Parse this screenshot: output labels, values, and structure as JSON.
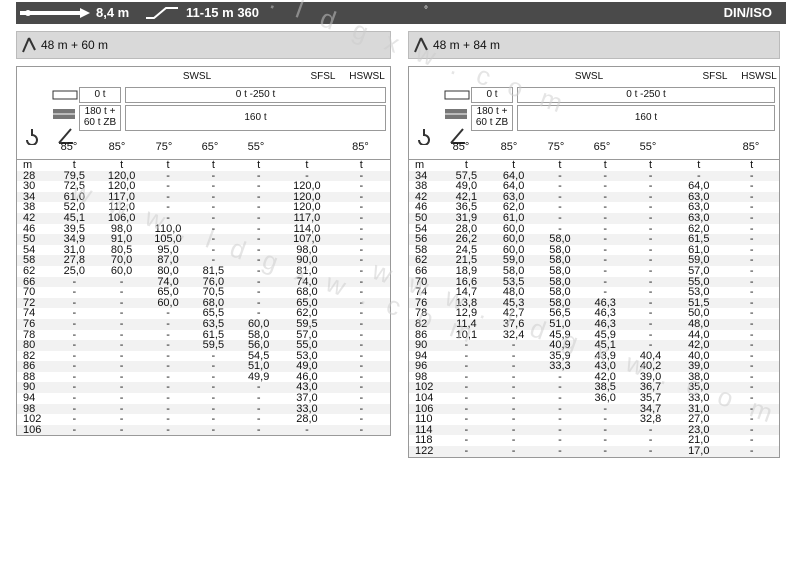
{
  "topbar": {
    "boom_length": "8,4 m",
    "range": "11-15 m 360",
    "dot": "°",
    "standard": "DIN/ISO"
  },
  "left": {
    "boom": "48 m + 60 m",
    "swsl": "SWSL",
    "sfsl": "SFSL",
    "hswsl": "HSWSL",
    "cw1": "0 t",
    "cw2": "0 t -250 t",
    "ballast1": "180 t +\n60 t ZB",
    "ballast2": "160 t",
    "angles": [
      "85°",
      "85°",
      "75°",
      "65°",
      "55°",
      "",
      "85°"
    ],
    "units": [
      "m",
      "t",
      "t",
      "t",
      "t",
      "t",
      "t",
      "t"
    ],
    "rows": [
      [
        "28",
        "79,5",
        "120,0",
        "-",
        "-",
        "-",
        "-",
        "-"
      ],
      [
        "30",
        "72,5",
        "120,0",
        "-",
        "-",
        "-",
        "120,0",
        "-"
      ],
      [
        "34",
        "61,0",
        "117,0",
        "-",
        "-",
        "-",
        "120,0",
        "-"
      ],
      [
        "38",
        "52,0",
        "112,0",
        "-",
        "-",
        "-",
        "120,0",
        "-"
      ],
      [
        "42",
        "45,1",
        "106,0",
        "-",
        "-",
        "-",
        "117,0",
        "-"
      ],
      [
        "46",
        "39,5",
        "98,0",
        "110,0",
        "-",
        "-",
        "114,0",
        "-"
      ],
      [
        "50",
        "34,9",
        "91,0",
        "105,0",
        "-",
        "-",
        "107,0",
        "-"
      ],
      [
        "54",
        "31,0",
        "80,5",
        "95,0",
        "-",
        "-",
        "98,0",
        "-"
      ],
      [
        "58",
        "27,8",
        "70,0",
        "87,0",
        "-",
        "-",
        "90,0",
        "-"
      ],
      [
        "62",
        "25,0",
        "60,0",
        "80,0",
        "81,5",
        "-",
        "81,0",
        "-"
      ],
      [
        "66",
        "-",
        "-",
        "74,0",
        "76,0",
        "-",
        "74,0",
        "-"
      ],
      [
        "70",
        "-",
        "-",
        "65,0",
        "70,5",
        "-",
        "68,0",
        "-"
      ],
      [
        "72",
        "-",
        "-",
        "60,0",
        "68,0",
        "-",
        "65,0",
        "-"
      ],
      [
        "74",
        "-",
        "-",
        "-",
        "65,5",
        "-",
        "62,0",
        "-"
      ],
      [
        "76",
        "-",
        "-",
        "-",
        "63,5",
        "60,0",
        "59,5",
        "-"
      ],
      [
        "78",
        "-",
        "-",
        "-",
        "61,5",
        "58,0",
        "57,0",
        "-"
      ],
      [
        "80",
        "-",
        "-",
        "-",
        "59,5",
        "56,0",
        "55,0",
        "-"
      ],
      [
        "82",
        "-",
        "-",
        "-",
        "-",
        "54,5",
        "53,0",
        "-"
      ],
      [
        "86",
        "-",
        "-",
        "-",
        "-",
        "51,0",
        "49,0",
        "-"
      ],
      [
        "88",
        "-",
        "-",
        "-",
        "-",
        "49,9",
        "46,0",
        "-"
      ],
      [
        "90",
        "-",
        "-",
        "-",
        "-",
        "-",
        "43,0",
        "-"
      ],
      [
        "94",
        "-",
        "-",
        "-",
        "-",
        "-",
        "37,0",
        "-"
      ],
      [
        "98",
        "-",
        "-",
        "-",
        "-",
        "-",
        "33,0",
        "-"
      ],
      [
        "102",
        "-",
        "-",
        "-",
        "-",
        "-",
        "28,0",
        "-"
      ],
      [
        "106",
        "-",
        "-",
        "-",
        "-",
        "-",
        "-",
        "-"
      ]
    ]
  },
  "right": {
    "boom": "48 m + 84 m",
    "swsl": "SWSL",
    "sfsl": "SFSL",
    "hswsl": "HSWSL",
    "cw1": "0 t",
    "cw2": "0 t -250 t",
    "ballast1": "180 t +\n60 t ZB",
    "ballast2": "160 t",
    "angles": [
      "85°",
      "85°",
      "75°",
      "65°",
      "55°",
      "",
      "85°"
    ],
    "units": [
      "m",
      "t",
      "t",
      "t",
      "t",
      "t",
      "t",
      "t"
    ],
    "rows": [
      [
        "34",
        "57,5",
        "64,0",
        "-",
        "-",
        "-",
        "-",
        "-"
      ],
      [
        "38",
        "49,0",
        "64,0",
        "-",
        "-",
        "-",
        "64,0",
        "-"
      ],
      [
        "42",
        "42,1",
        "63,0",
        "-",
        "-",
        "-",
        "63,0",
        "-"
      ],
      [
        "46",
        "36,5",
        "62,0",
        "-",
        "-",
        "-",
        "63,0",
        "-"
      ],
      [
        "50",
        "31,9",
        "61,0",
        "-",
        "-",
        "-",
        "63,0",
        "-"
      ],
      [
        "54",
        "28,0",
        "60,0",
        "-",
        "-",
        "-",
        "62,0",
        "-"
      ],
      [
        "56",
        "26,2",
        "60,0",
        "58,0",
        "-",
        "-",
        "61,5",
        "-"
      ],
      [
        "58",
        "24,5",
        "60,0",
        "58,0",
        "-",
        "-",
        "61,0",
        "-"
      ],
      [
        "62",
        "21,5",
        "59,0",
        "58,0",
        "-",
        "-",
        "59,0",
        "-"
      ],
      [
        "66",
        "18,9",
        "58,0",
        "58,0",
        "-",
        "-",
        "57,0",
        "-"
      ],
      [
        "70",
        "16,6",
        "53,5",
        "58,0",
        "-",
        "-",
        "55,0",
        "-"
      ],
      [
        "74",
        "14,7",
        "48,0",
        "58,0",
        "-",
        "-",
        "53,0",
        "-"
      ],
      [
        "76",
        "13,8",
        "45,3",
        "58,0",
        "46,3",
        "-",
        "51,5",
        "-"
      ],
      [
        "78",
        "12,9",
        "42,7",
        "56,5",
        "46,3",
        "-",
        "50,0",
        "-"
      ],
      [
        "82",
        "11,4",
        "37,6",
        "51,0",
        "46,3",
        "-",
        "48,0",
        "-"
      ],
      [
        "86",
        "10,1",
        "32,4",
        "45,9",
        "45,9",
        "-",
        "44,0",
        "-"
      ],
      [
        "90",
        "-",
        "-",
        "40,9",
        "45,1",
        "-",
        "42,0",
        "-"
      ],
      [
        "94",
        "-",
        "-",
        "35,9",
        "43,9",
        "40,4",
        "40,0",
        "-"
      ],
      [
        "96",
        "-",
        "-",
        "33,3",
        "43,0",
        "40,2",
        "39,0",
        "-"
      ],
      [
        "98",
        "-",
        "-",
        "-",
        "42,0",
        "39,0",
        "38,0",
        "-"
      ],
      [
        "102",
        "-",
        "-",
        "-",
        "38,5",
        "36,7",
        "35,0",
        "-"
      ],
      [
        "104",
        "-",
        "-",
        "-",
        "36,0",
        "35,7",
        "33,0",
        "-"
      ],
      [
        "106",
        "-",
        "-",
        "-",
        "-",
        "34,7",
        "31,0",
        "-"
      ],
      [
        "110",
        "-",
        "-",
        "-",
        "-",
        "32,8",
        "27,0",
        "-"
      ],
      [
        "114",
        "-",
        "-",
        "-",
        "-",
        "-",
        "23,0",
        "-"
      ],
      [
        "118",
        "-",
        "-",
        "-",
        "-",
        "-",
        "21,0",
        "-"
      ],
      [
        "122",
        "-",
        "-",
        "-",
        "-",
        "-",
        "17,0",
        "-"
      ]
    ]
  },
  "watermark": "www.ldgxw.com"
}
